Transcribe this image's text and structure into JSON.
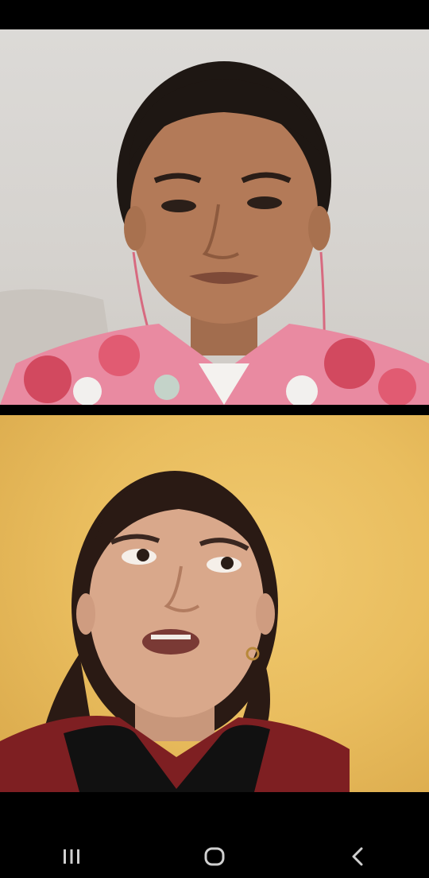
{
  "call": {
    "participants": [
      {
        "tile": "top",
        "background": "#d8d5d1"
      },
      {
        "tile": "bottom",
        "background": "#e9bd5e"
      }
    ]
  },
  "navigation_bar": {
    "buttons": [
      {
        "icon": "recent-apps-icon"
      },
      {
        "icon": "home-icon"
      },
      {
        "icon": "back-icon"
      }
    ],
    "icon_color": "#d0d0d0"
  }
}
